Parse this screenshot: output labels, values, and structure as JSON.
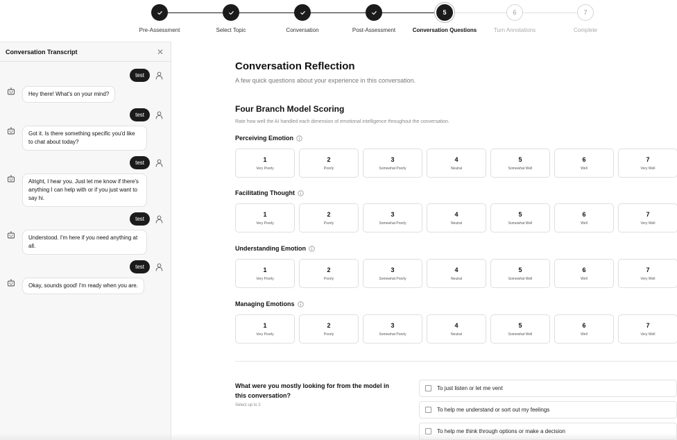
{
  "stepper": {
    "steps": [
      {
        "label": "Pre-Assessment",
        "state": "done",
        "number": "1"
      },
      {
        "label": "Select Topic",
        "state": "done",
        "number": "2"
      },
      {
        "label": "Conversation",
        "state": "done",
        "number": "3"
      },
      {
        "label": "Post-Assessment",
        "state": "done",
        "number": "4"
      },
      {
        "label": "Conversation Questions",
        "state": "current",
        "number": "5"
      },
      {
        "label": "Turn Annotations",
        "state": "todo",
        "number": "6"
      },
      {
        "label": "Complete",
        "state": "todo",
        "number": "7"
      }
    ]
  },
  "sidebar": {
    "title": "Conversation Transcript",
    "messages": [
      {
        "role": "user",
        "text": "test"
      },
      {
        "role": "bot",
        "text": "Hey there! What's on your mind?"
      },
      {
        "role": "user",
        "text": "test"
      },
      {
        "role": "bot",
        "text": "Got it. Is there something specific you'd like to chat about today?"
      },
      {
        "role": "user",
        "text": "test"
      },
      {
        "role": "bot",
        "text": "Alright, I hear you. Just let me know if there's anything I can help with or if you just want to say hi."
      },
      {
        "role": "user",
        "text": "test"
      },
      {
        "role": "bot",
        "text": "Understood. I'm here if you need anything at all."
      },
      {
        "role": "user",
        "text": "test"
      },
      {
        "role": "bot",
        "text": "Okay, sounds good! I'm ready when you are."
      }
    ]
  },
  "main": {
    "title": "Conversation Reflection",
    "subtitle": "A few quick questions about your experience in this conversation.",
    "section_title": "Four Branch Model Scoring",
    "section_subtitle": "Rate how well the AI handled each dimension of emotional intelligence throughout the conversation.",
    "scale_options": [
      {
        "value": "1",
        "label": "Very Poorly"
      },
      {
        "value": "2",
        "label": "Poorly"
      },
      {
        "value": "3",
        "label": "Somewhat Poorly"
      },
      {
        "value": "4",
        "label": "Neutral"
      },
      {
        "value": "5",
        "label": "Somewhat Well"
      },
      {
        "value": "6",
        "label": "Well"
      },
      {
        "value": "7",
        "label": "Very Well"
      }
    ],
    "dimensions": [
      {
        "name": "Perceiving Emotion"
      },
      {
        "name": "Facilitating Thought"
      },
      {
        "name": "Understanding Emotion"
      },
      {
        "name": "Managing Emotions"
      }
    ],
    "question": {
      "title": "What were you mostly looking for from the model in this conversation?",
      "hint": "Select up to 2",
      "choices": [
        "To just listen or let me vent",
        "To help me understand or sort out my feelings",
        "To help me think through options or make a decision"
      ]
    }
  },
  "icons": {
    "step_done": "check-icon",
    "user": "user-icon",
    "bot": "bot-icon",
    "info": "info-icon",
    "close": "close-icon"
  },
  "colors": {
    "accent": "#1b1b1b",
    "border": "#dedede",
    "muted": "#777777"
  }
}
